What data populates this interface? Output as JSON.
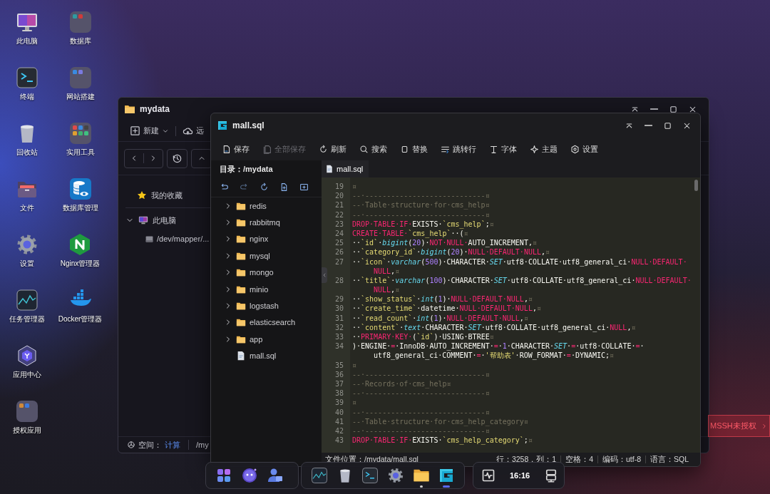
{
  "desktop": {
    "icons": [
      {
        "label": "此电脑"
      },
      {
        "label": "终端"
      },
      {
        "label": "回收站"
      },
      {
        "label": "文件"
      },
      {
        "label": "设置"
      },
      {
        "label": "任务管理器"
      },
      {
        "label": "应用中心"
      },
      {
        "label": "授权应用"
      },
      {
        "label": "数据库"
      },
      {
        "label": "网站搭建"
      },
      {
        "label": "实用工具"
      },
      {
        "label": "数据库管理"
      },
      {
        "label": "Nginx管理器"
      },
      {
        "label": "Docker管理器"
      }
    ]
  },
  "files_window": {
    "title": "mydata",
    "toolbar": [
      {
        "label": "新建"
      },
      {
        "label": "远"
      }
    ],
    "sidebar": {
      "favorites": "我的收藏",
      "this_pc": {
        "label": "此电脑",
        "expanded": true,
        "children": [
          {
            "label": "/dev/mapper/..."
          }
        ]
      }
    },
    "status_bar": {
      "space_label": "空间：",
      "space_value": "计算",
      "path": "/my"
    }
  },
  "notice": {
    "text": "MSSH未授权"
  },
  "editor": {
    "title": "mall.sql",
    "toolbar": [
      {
        "label": "保存",
        "disabled": false
      },
      {
        "label": "全部保存",
        "disabled": true
      },
      {
        "label": "刷新",
        "disabled": false
      },
      {
        "label": "搜索",
        "disabled": false
      },
      {
        "label": "替换",
        "disabled": false
      },
      {
        "label": "跳转行",
        "disabled": false
      },
      {
        "label": "字体",
        "disabled": false
      },
      {
        "label": "主题",
        "disabled": false
      },
      {
        "label": "设置",
        "disabled": false
      }
    ],
    "directory": "目录：/mydata",
    "tree": [
      {
        "name": "redis",
        "kind": "folder",
        "expanded": false
      },
      {
        "name": "rabbitmq",
        "kind": "folder",
        "expanded": false
      },
      {
        "name": "nginx",
        "kind": "folder",
        "expanded": false
      },
      {
        "name": "mysql",
        "kind": "folder",
        "expanded": false
      },
      {
        "name": "mongo",
        "kind": "folder",
        "expanded": false
      },
      {
        "name": "minio",
        "kind": "folder",
        "expanded": false
      },
      {
        "name": "logstash",
        "kind": "folder",
        "expanded": false
      },
      {
        "name": "elasticsearch",
        "kind": "folder",
        "expanded": false
      },
      {
        "name": "app",
        "kind": "folder",
        "expanded": false
      },
      {
        "name": "mall.sql",
        "kind": "file"
      }
    ],
    "tabs": [
      {
        "label": "mall.sql",
        "selected": true
      }
    ],
    "code": [
      {
        "number": "19",
        "tokens": [
          {
            "kind": "comment",
            "text": "¤"
          }
        ]
      },
      {
        "number": "20",
        "tokens": [
          {
            "kind": "comment",
            "text": "--·----------------------------¤"
          }
        ]
      },
      {
        "number": "21",
        "tokens": [
          {
            "kind": "comment",
            "text": "--·Table·structure·for·cms_help¤"
          }
        ]
      },
      {
        "number": "22",
        "tokens": [
          {
            "kind": "comment",
            "text": "--·----------------------------¤"
          }
        ]
      },
      {
        "number": "23",
        "tokens": [
          {
            "kind": "keyword",
            "text": "DROP·TABLE·IF·"
          },
          {
            "kind": "plain",
            "text": "EXISTS·"
          },
          {
            "kind": "string",
            "text": "`cms_help`"
          },
          {
            "kind": "plain",
            "text": ";"
          },
          {
            "kind": "comment",
            "text": "¤"
          }
        ]
      },
      {
        "number": "24",
        "tokens": [
          {
            "kind": "keyword",
            "text": "CREATE·TABLE·"
          },
          {
            "kind": "string",
            "text": "`cms_help`"
          },
          {
            "kind": "plain",
            "text": "··("
          },
          {
            "kind": "comment",
            "text": "¤"
          }
        ]
      },
      {
        "number": "25",
        "tokens": [
          {
            "kind": "plain",
            "text": "··"
          },
          {
            "kind": "string",
            "text": "`id`"
          },
          {
            "kind": "plain",
            "text": "·"
          },
          {
            "kind": "type",
            "text": "bigint"
          },
          {
            "kind": "plain",
            "text": "("
          },
          {
            "kind": "number",
            "text": "20"
          },
          {
            "kind": "plain",
            "text": ")·"
          },
          {
            "kind": "keyword",
            "text": "NOT·NULL·"
          },
          {
            "kind": "plain",
            "text": "AUTO_INCREMENT,"
          },
          {
            "kind": "comment",
            "text": "¤"
          }
        ]
      },
      {
        "number": "26",
        "tokens": [
          {
            "kind": "plain",
            "text": "··"
          },
          {
            "kind": "string",
            "text": "`category_id`"
          },
          {
            "kind": "plain",
            "text": "·"
          },
          {
            "kind": "type",
            "text": "bigint"
          },
          {
            "kind": "plain",
            "text": "("
          },
          {
            "kind": "number",
            "text": "20"
          },
          {
            "kind": "plain",
            "text": ")·"
          },
          {
            "kind": "keyword",
            "text": "NULL·DEFAULT·NULL"
          },
          {
            "kind": "plain",
            "text": ","
          },
          {
            "kind": "comment",
            "text": "¤"
          }
        ]
      },
      {
        "number": "27",
        "tokens": [
          {
            "kind": "plain",
            "text": "··"
          },
          {
            "kind": "string",
            "text": "`icon`"
          },
          {
            "kind": "plain",
            "text": "·"
          },
          {
            "kind": "type",
            "text": "varchar"
          },
          {
            "kind": "plain",
            "text": "("
          },
          {
            "kind": "number",
            "text": "500"
          },
          {
            "kind": "plain",
            "text": ")·CHARACTER·"
          },
          {
            "kind": "type",
            "text": "SET"
          },
          {
            "kind": "plain",
            "text": "·utf8·COLLATE·utf8_general_ci·"
          },
          {
            "kind": "keyword",
            "text": "NULL·DEFAULT·"
          }
        ],
        "continuation": [
          {
            "kind": "keyword",
            "text": "NULL"
          },
          {
            "kind": "plain",
            "text": ","
          },
          {
            "kind": "comment",
            "text": "¤"
          }
        ]
      },
      {
        "number": "28",
        "tokens": [
          {
            "kind": "plain",
            "text": "··"
          },
          {
            "kind": "string",
            "text": "`title`"
          },
          {
            "kind": "plain",
            "text": "·"
          },
          {
            "kind": "type",
            "text": "varchar"
          },
          {
            "kind": "plain",
            "text": "("
          },
          {
            "kind": "number",
            "text": "100"
          },
          {
            "kind": "plain",
            "text": ")·CHARACTER·"
          },
          {
            "kind": "type",
            "text": "SET"
          },
          {
            "kind": "plain",
            "text": "·utf8·COLLATE·utf8_general_ci·"
          },
          {
            "kind": "keyword",
            "text": "NULL·DEFAULT·"
          }
        ],
        "continuation": [
          {
            "kind": "keyword",
            "text": "NULL"
          },
          {
            "kind": "plain",
            "text": ","
          },
          {
            "kind": "comment",
            "text": "¤"
          }
        ]
      },
      {
        "number": "29",
        "tokens": [
          {
            "kind": "plain",
            "text": "··"
          },
          {
            "kind": "string",
            "text": "`show_status`"
          },
          {
            "kind": "plain",
            "text": "·"
          },
          {
            "kind": "type",
            "text": "int"
          },
          {
            "kind": "plain",
            "text": "("
          },
          {
            "kind": "number",
            "text": "1"
          },
          {
            "kind": "plain",
            "text": ")·"
          },
          {
            "kind": "keyword",
            "text": "NULL·DEFAULT·NULL"
          },
          {
            "kind": "plain",
            "text": ","
          },
          {
            "kind": "comment",
            "text": "¤"
          }
        ]
      },
      {
        "number": "30",
        "tokens": [
          {
            "kind": "plain",
            "text": "··"
          },
          {
            "kind": "string",
            "text": "`create_time`"
          },
          {
            "kind": "plain",
            "text": "·datetime·"
          },
          {
            "kind": "keyword",
            "text": "NULL·DEFAULT·NULL"
          },
          {
            "kind": "plain",
            "text": ","
          },
          {
            "kind": "comment",
            "text": "¤"
          }
        ]
      },
      {
        "number": "31",
        "tokens": [
          {
            "kind": "plain",
            "text": "··"
          },
          {
            "kind": "string",
            "text": "`read_count`"
          },
          {
            "kind": "plain",
            "text": "·"
          },
          {
            "kind": "type",
            "text": "int"
          },
          {
            "kind": "plain",
            "text": "("
          },
          {
            "kind": "number",
            "text": "1"
          },
          {
            "kind": "plain",
            "text": ")·"
          },
          {
            "kind": "keyword",
            "text": "NULL·DEFAULT·NULL"
          },
          {
            "kind": "plain",
            "text": ","
          },
          {
            "kind": "comment",
            "text": "¤"
          }
        ]
      },
      {
        "number": "32",
        "tokens": [
          {
            "kind": "plain",
            "text": "··"
          },
          {
            "kind": "string",
            "text": "`content`"
          },
          {
            "kind": "plain",
            "text": "·"
          },
          {
            "kind": "type",
            "text": "text"
          },
          {
            "kind": "plain",
            "text": "·CHARACTER·"
          },
          {
            "kind": "type",
            "text": "SET"
          },
          {
            "kind": "plain",
            "text": "·utf8·COLLATE·utf8_general_ci·"
          },
          {
            "kind": "keyword",
            "text": "NULL"
          },
          {
            "kind": "plain",
            "text": ","
          },
          {
            "kind": "comment",
            "text": "¤"
          }
        ]
      },
      {
        "number": "33",
        "tokens": [
          {
            "kind": "plain",
            "text": "··"
          },
          {
            "kind": "keyword",
            "text": "PRIMARY·KEY·"
          },
          {
            "kind": "plain",
            "text": "("
          },
          {
            "kind": "string",
            "text": "`id`"
          },
          {
            "kind": "plain",
            "text": ")·USING·BTREE"
          },
          {
            "kind": "comment",
            "text": "¤"
          }
        ]
      },
      {
        "number": "34",
        "tokens": [
          {
            "kind": "plain",
            "text": ")·ENGINE·"
          },
          {
            "kind": "keyword",
            "text": "="
          },
          {
            "kind": "plain",
            "text": "·InnoDB·AUTO_INCREMENT·"
          },
          {
            "kind": "keyword",
            "text": "="
          },
          {
            "kind": "plain",
            "text": "·"
          },
          {
            "kind": "number",
            "text": "1"
          },
          {
            "kind": "plain",
            "text": "·CHARACTER·"
          },
          {
            "kind": "type",
            "text": "SET"
          },
          {
            "kind": "plain",
            "text": "·"
          },
          {
            "kind": "keyword",
            "text": "="
          },
          {
            "kind": "plain",
            "text": "·utf8·COLLATE·"
          },
          {
            "kind": "keyword",
            "text": "="
          },
          {
            "kind": "plain",
            "text": "·"
          }
        ],
        "continuation": [
          {
            "kind": "plain",
            "text": "utf8_general_ci·COMMENT·"
          },
          {
            "kind": "keyword",
            "text": "="
          },
          {
            "kind": "plain",
            "text": "·"
          },
          {
            "kind": "string",
            "text": "'帮助表'"
          },
          {
            "kind": "plain",
            "text": "·ROW_FORMAT·"
          },
          {
            "kind": "keyword",
            "text": "="
          },
          {
            "kind": "plain",
            "text": "·DYNAMIC;"
          },
          {
            "kind": "comment",
            "text": "¤"
          }
        ]
      },
      {
        "number": "35",
        "tokens": [
          {
            "kind": "comment",
            "text": "¤"
          }
        ]
      },
      {
        "number": "36",
        "tokens": [
          {
            "kind": "comment",
            "text": "--·----------------------------¤"
          }
        ]
      },
      {
        "number": "37",
        "tokens": [
          {
            "kind": "comment",
            "text": "--·Records·of·cms_help¤"
          }
        ]
      },
      {
        "number": "38",
        "tokens": [
          {
            "kind": "comment",
            "text": "--·----------------------------¤"
          }
        ]
      },
      {
        "number": "39",
        "tokens": [
          {
            "kind": "comment",
            "text": "¤"
          }
        ]
      },
      {
        "number": "40",
        "tokens": [
          {
            "kind": "comment",
            "text": "--·----------------------------¤"
          }
        ]
      },
      {
        "number": "41",
        "tokens": [
          {
            "kind": "comment",
            "text": "--·Table·structure·for·cms_help_category¤"
          }
        ]
      },
      {
        "number": "42",
        "tokens": [
          {
            "kind": "comment",
            "text": "--·----------------------------¤"
          }
        ]
      },
      {
        "number": "43",
        "tokens": [
          {
            "kind": "keyword",
            "text": "DROP·TABLE·IF·"
          },
          {
            "kind": "plain",
            "text": "EXISTS·"
          },
          {
            "kind": "string",
            "text": "`cms_help_category`"
          },
          {
            "kind": "plain",
            "text": ";"
          },
          {
            "kind": "comment",
            "text": "¤"
          }
        ]
      }
    ],
    "status_bar": {
      "file": "文件位置：/mydata/mall.sql",
      "items": [
        "行：3258，列：1",
        "空格：4",
        "编码：utf-8",
        "语言：SQL"
      ]
    }
  },
  "taskbar": {
    "apps": [
      {
        "open": false,
        "focused": false
      },
      {
        "open": false,
        "focused": false
      },
      {
        "open": false,
        "focused": false
      },
      {
        "open": false,
        "focused": false
      },
      {
        "open": true,
        "focused": false
      },
      {
        "open": true,
        "focused": true
      }
    ],
    "clock": "16:16"
  }
}
